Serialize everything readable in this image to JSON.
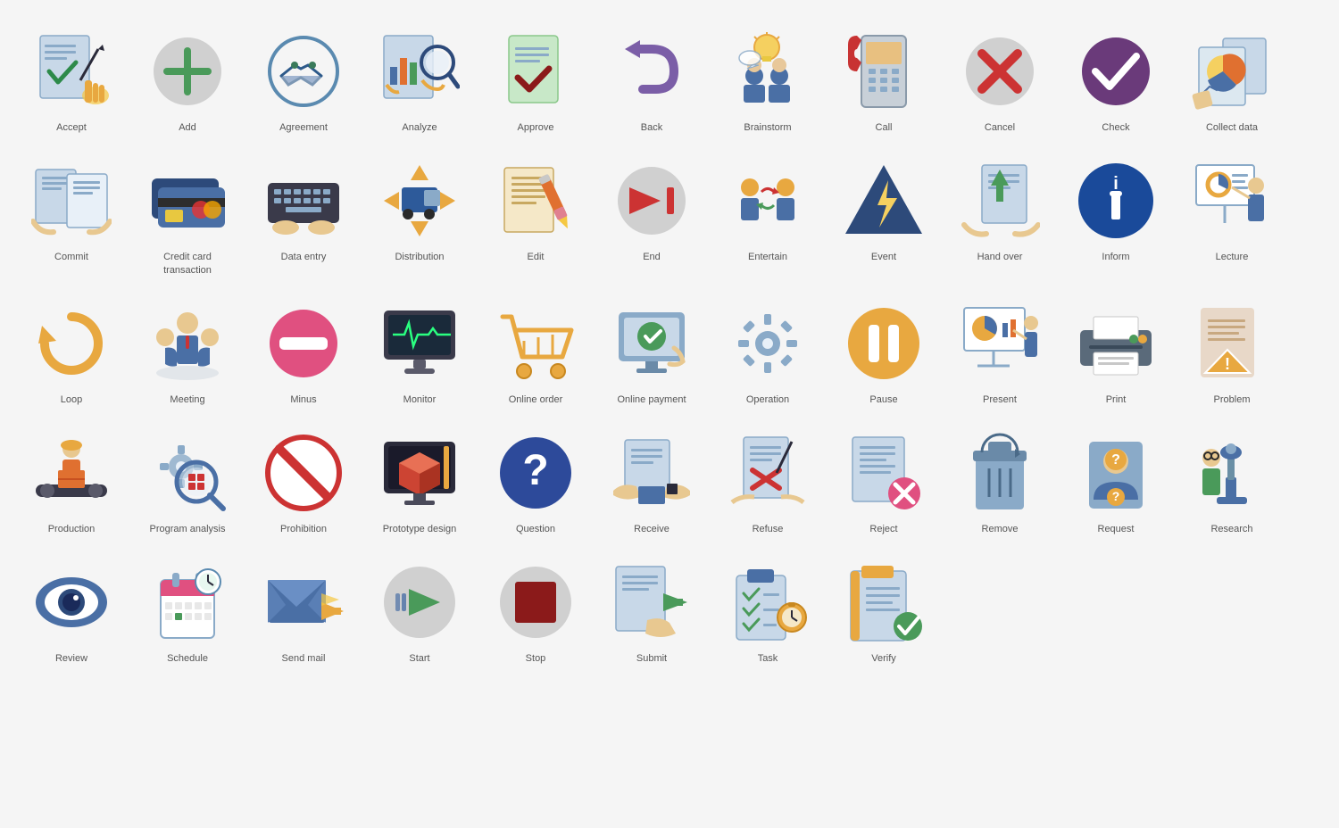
{
  "icons": [
    {
      "id": "accept",
      "label": "Accept"
    },
    {
      "id": "add",
      "label": "Add"
    },
    {
      "id": "agreement",
      "label": "Agreement"
    },
    {
      "id": "analyze",
      "label": "Analyze"
    },
    {
      "id": "approve",
      "label": "Approve"
    },
    {
      "id": "back",
      "label": "Back"
    },
    {
      "id": "brainstorm",
      "label": "Brainstorm"
    },
    {
      "id": "call",
      "label": "Call"
    },
    {
      "id": "cancel",
      "label": "Cancel"
    },
    {
      "id": "check",
      "label": "Check"
    },
    {
      "id": "collect-data",
      "label": "Collect data"
    },
    {
      "id": "commit",
      "label": "Commit"
    },
    {
      "id": "credit-card",
      "label": "Credit card transaction"
    },
    {
      "id": "data-entry",
      "label": "Data entry"
    },
    {
      "id": "distribution",
      "label": "Distribution"
    },
    {
      "id": "edit",
      "label": "Edit"
    },
    {
      "id": "end",
      "label": "End"
    },
    {
      "id": "entertain",
      "label": "Entertain"
    },
    {
      "id": "event",
      "label": "Event"
    },
    {
      "id": "hand-over",
      "label": "Hand over"
    },
    {
      "id": "inform",
      "label": "Inform"
    },
    {
      "id": "lecture",
      "label": "Lecture"
    },
    {
      "id": "loop",
      "label": "Loop"
    },
    {
      "id": "meeting",
      "label": "Meeting"
    },
    {
      "id": "minus",
      "label": "Minus"
    },
    {
      "id": "monitor",
      "label": "Monitor"
    },
    {
      "id": "online-order",
      "label": "Online order"
    },
    {
      "id": "online-payment",
      "label": "Online payment"
    },
    {
      "id": "operation",
      "label": "Operation"
    },
    {
      "id": "pause",
      "label": "Pause"
    },
    {
      "id": "present",
      "label": "Present"
    },
    {
      "id": "print",
      "label": "Print"
    },
    {
      "id": "problem",
      "label": "Problem"
    },
    {
      "id": "production",
      "label": "Production"
    },
    {
      "id": "program-analysis",
      "label": "Program analysis"
    },
    {
      "id": "prohibition",
      "label": "Prohibition"
    },
    {
      "id": "prototype-design",
      "label": "Prototype design"
    },
    {
      "id": "question",
      "label": "Question"
    },
    {
      "id": "receive",
      "label": "Receive"
    },
    {
      "id": "refuse",
      "label": "Refuse"
    },
    {
      "id": "reject",
      "label": "Reject"
    },
    {
      "id": "remove",
      "label": "Remove"
    },
    {
      "id": "request",
      "label": "Request"
    },
    {
      "id": "research",
      "label": "Research"
    },
    {
      "id": "review",
      "label": "Review"
    },
    {
      "id": "schedule",
      "label": "Schedule"
    },
    {
      "id": "send-mail",
      "label": "Send mail"
    },
    {
      "id": "start",
      "label": "Start"
    },
    {
      "id": "stop",
      "label": "Stop"
    },
    {
      "id": "submit",
      "label": "Submit"
    },
    {
      "id": "task",
      "label": "Task"
    },
    {
      "id": "verify",
      "label": "Verify"
    }
  ]
}
